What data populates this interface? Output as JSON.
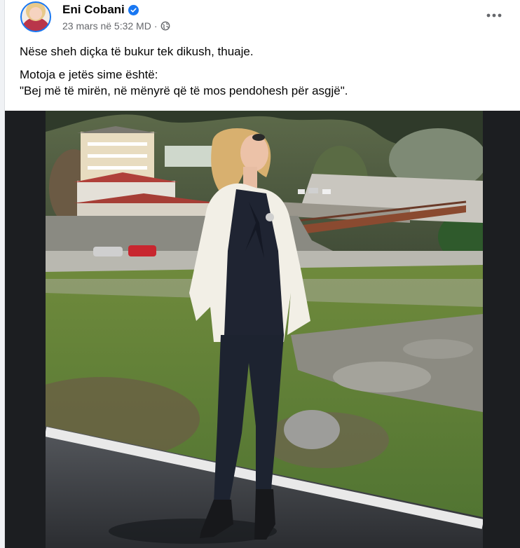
{
  "post": {
    "author": "Eni Cobani",
    "verified_icon": "verified-badge-icon",
    "timestamp": "23 mars në 5:32 MD",
    "separator": "·",
    "audience_icon": "globe-icon",
    "more_icon": "more-options-icon",
    "text_lines": [
      "Nëse sheh diçka të bukur tek dikush, thuaje.",
      "Motoja e jetës sime është:",
      "\"Bej më të mirën, në mënyrë që të mos pendohesh për asgjë\"."
    ]
  },
  "colors": {
    "brand_blue": "#1877f2",
    "text_primary": "#050505",
    "text_secondary": "#65676b",
    "photo_letterbox": "#1c1e21"
  }
}
